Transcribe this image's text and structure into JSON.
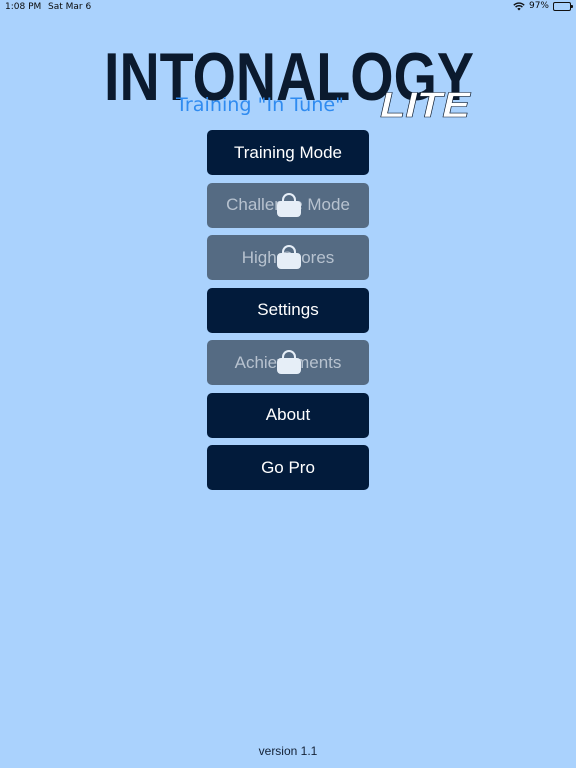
{
  "status_bar": {
    "time": "1:08 PM",
    "date": "Sat Mar 6",
    "battery": "97%",
    "battery_level": 0.97
  },
  "logo": {
    "title": "INTONALOGY",
    "tagline": "Training \"In Tune\"",
    "edition": "LITE",
    "colors": {
      "dark": "#0b1a2e",
      "blue": "#2f8bf0",
      "white": "#ffffff"
    }
  },
  "menu": {
    "items": [
      {
        "label": "Training Mode",
        "locked": false,
        "icon": ""
      },
      {
        "label": "Challenge Mode",
        "locked": true,
        "icon": "lock-icon"
      },
      {
        "label": "High Scores",
        "locked": true,
        "icon": "lock-icon"
      },
      {
        "label": "Settings",
        "locked": false,
        "icon": ""
      },
      {
        "label": "Achievements",
        "locked": true,
        "icon": "lock-icon"
      },
      {
        "label": "About",
        "locked": false,
        "icon": ""
      },
      {
        "label": "Go Pro",
        "locked": false,
        "icon": ""
      }
    ],
    "colors": {
      "active_bg": "#021b3b",
      "locked_bg": "#556b83",
      "page_bg": "#aad2fd"
    }
  },
  "footer": {
    "version": "version 1.1"
  }
}
